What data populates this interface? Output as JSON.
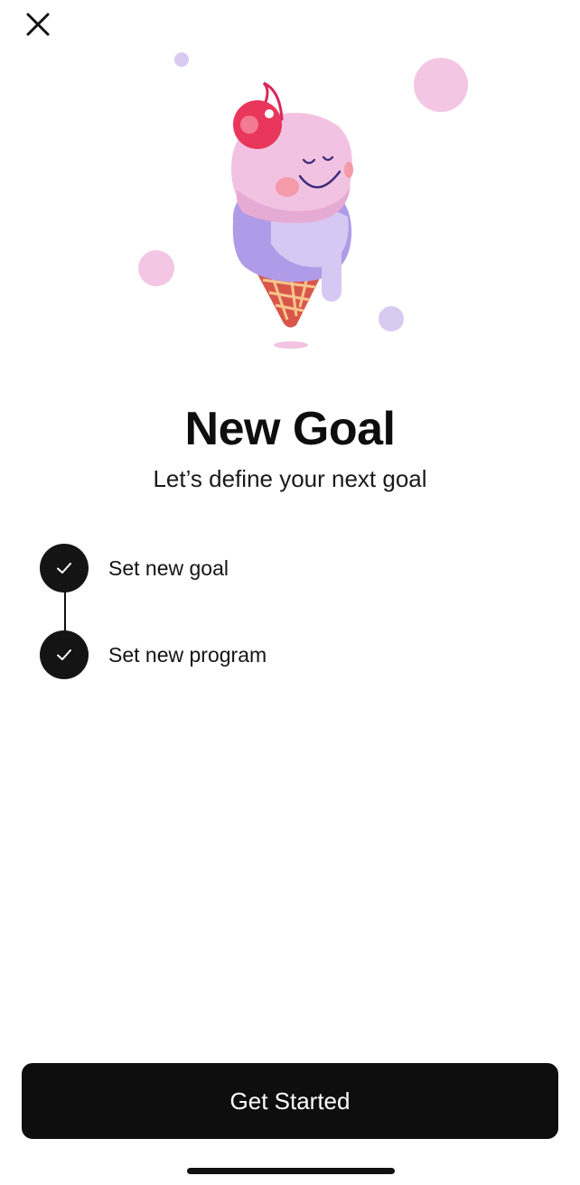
{
  "header": {
    "close_icon": "close-icon"
  },
  "illustration": {
    "name": "ice-cream-character",
    "colors": {
      "scoop_pink": "#f2c2e2",
      "scoop_purple": "#b9a3ec",
      "cherry": "#e8375a",
      "cone": "#d9574a",
      "cone_stripes": "#f7c58c",
      "bubble_pink": "#f3c6e3",
      "bubble_lavender": "#d8c9f0"
    }
  },
  "main": {
    "title": "New Goal",
    "subtitle": "Let’s define your next goal",
    "steps": [
      {
        "label": "Set new goal",
        "icon": "check-icon",
        "completed": true
      },
      {
        "label": "Set new program",
        "icon": "check-icon",
        "completed": true
      }
    ]
  },
  "footer": {
    "cta_label": "Get Started"
  },
  "colors": {
    "background": "#ffffff",
    "primary_dark": "#0e0e0e",
    "button_text": "#ffffff"
  }
}
